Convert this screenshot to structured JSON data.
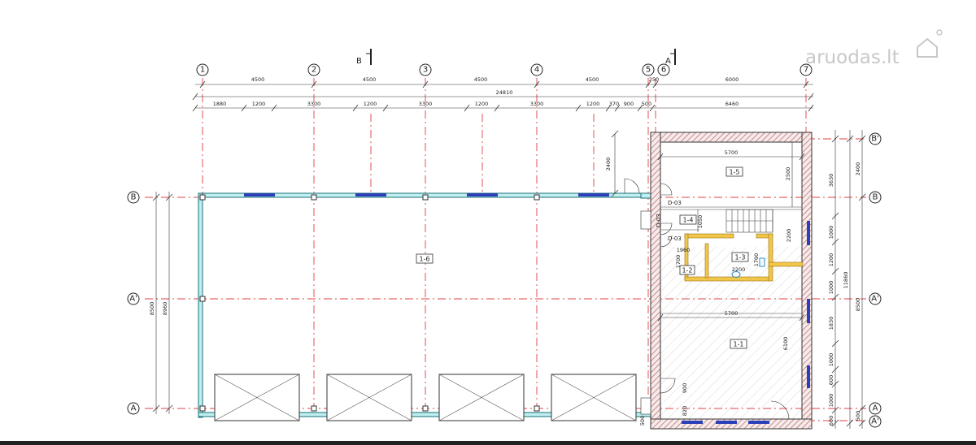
{
  "watermark": "aruodas.lt",
  "axes_vertical": [
    "1",
    "2",
    "3",
    "4",
    "5",
    "6",
    "7"
  ],
  "axes_horizontal": [
    "B'",
    "B",
    "A'",
    "A",
    "A'"
  ],
  "section_marks": [
    "B",
    "A"
  ],
  "dims_top_row1": [
    "4500",
    "4500",
    "4500",
    "4500",
    "250",
    "6000"
  ],
  "dim_total": "24810",
  "dims_top_row2": [
    "1880",
    "1200",
    "3300",
    "1200",
    "3300",
    "1200",
    "3300",
    "1200",
    "370",
    "900",
    "500",
    "6460"
  ],
  "dims_left": [
    "8960",
    "8500"
  ],
  "dims_right_inner": [
    "3630",
    "1000",
    "1200",
    "1000",
    "1830",
    "1000",
    "600",
    "1000",
    "600"
  ],
  "dims_right_mid": [
    "2400",
    "11860",
    "8500",
    "500"
  ],
  "dims_right_outer": [
    "2400"
  ],
  "dim_misc": {
    "d2400": "2400",
    "d2500": "2500",
    "d5700a": "5700",
    "d5700b": "5700",
    "d1050": "1050",
    "d2200v": "2200",
    "d1960": "1960",
    "d1700a": "1700",
    "d1700b": "1700",
    "d2200h": "2200",
    "d6100": "6100",
    "d900": "900",
    "d820": "820",
    "d500": "500"
  },
  "rooms": {
    "r15": "1-5",
    "r14": "1-4",
    "r13": "1-3",
    "r12": "1-2",
    "r11": "1-1",
    "r16": "1-6"
  },
  "door_tags": [
    "D-03",
    "D-03",
    "D-03"
  ]
}
